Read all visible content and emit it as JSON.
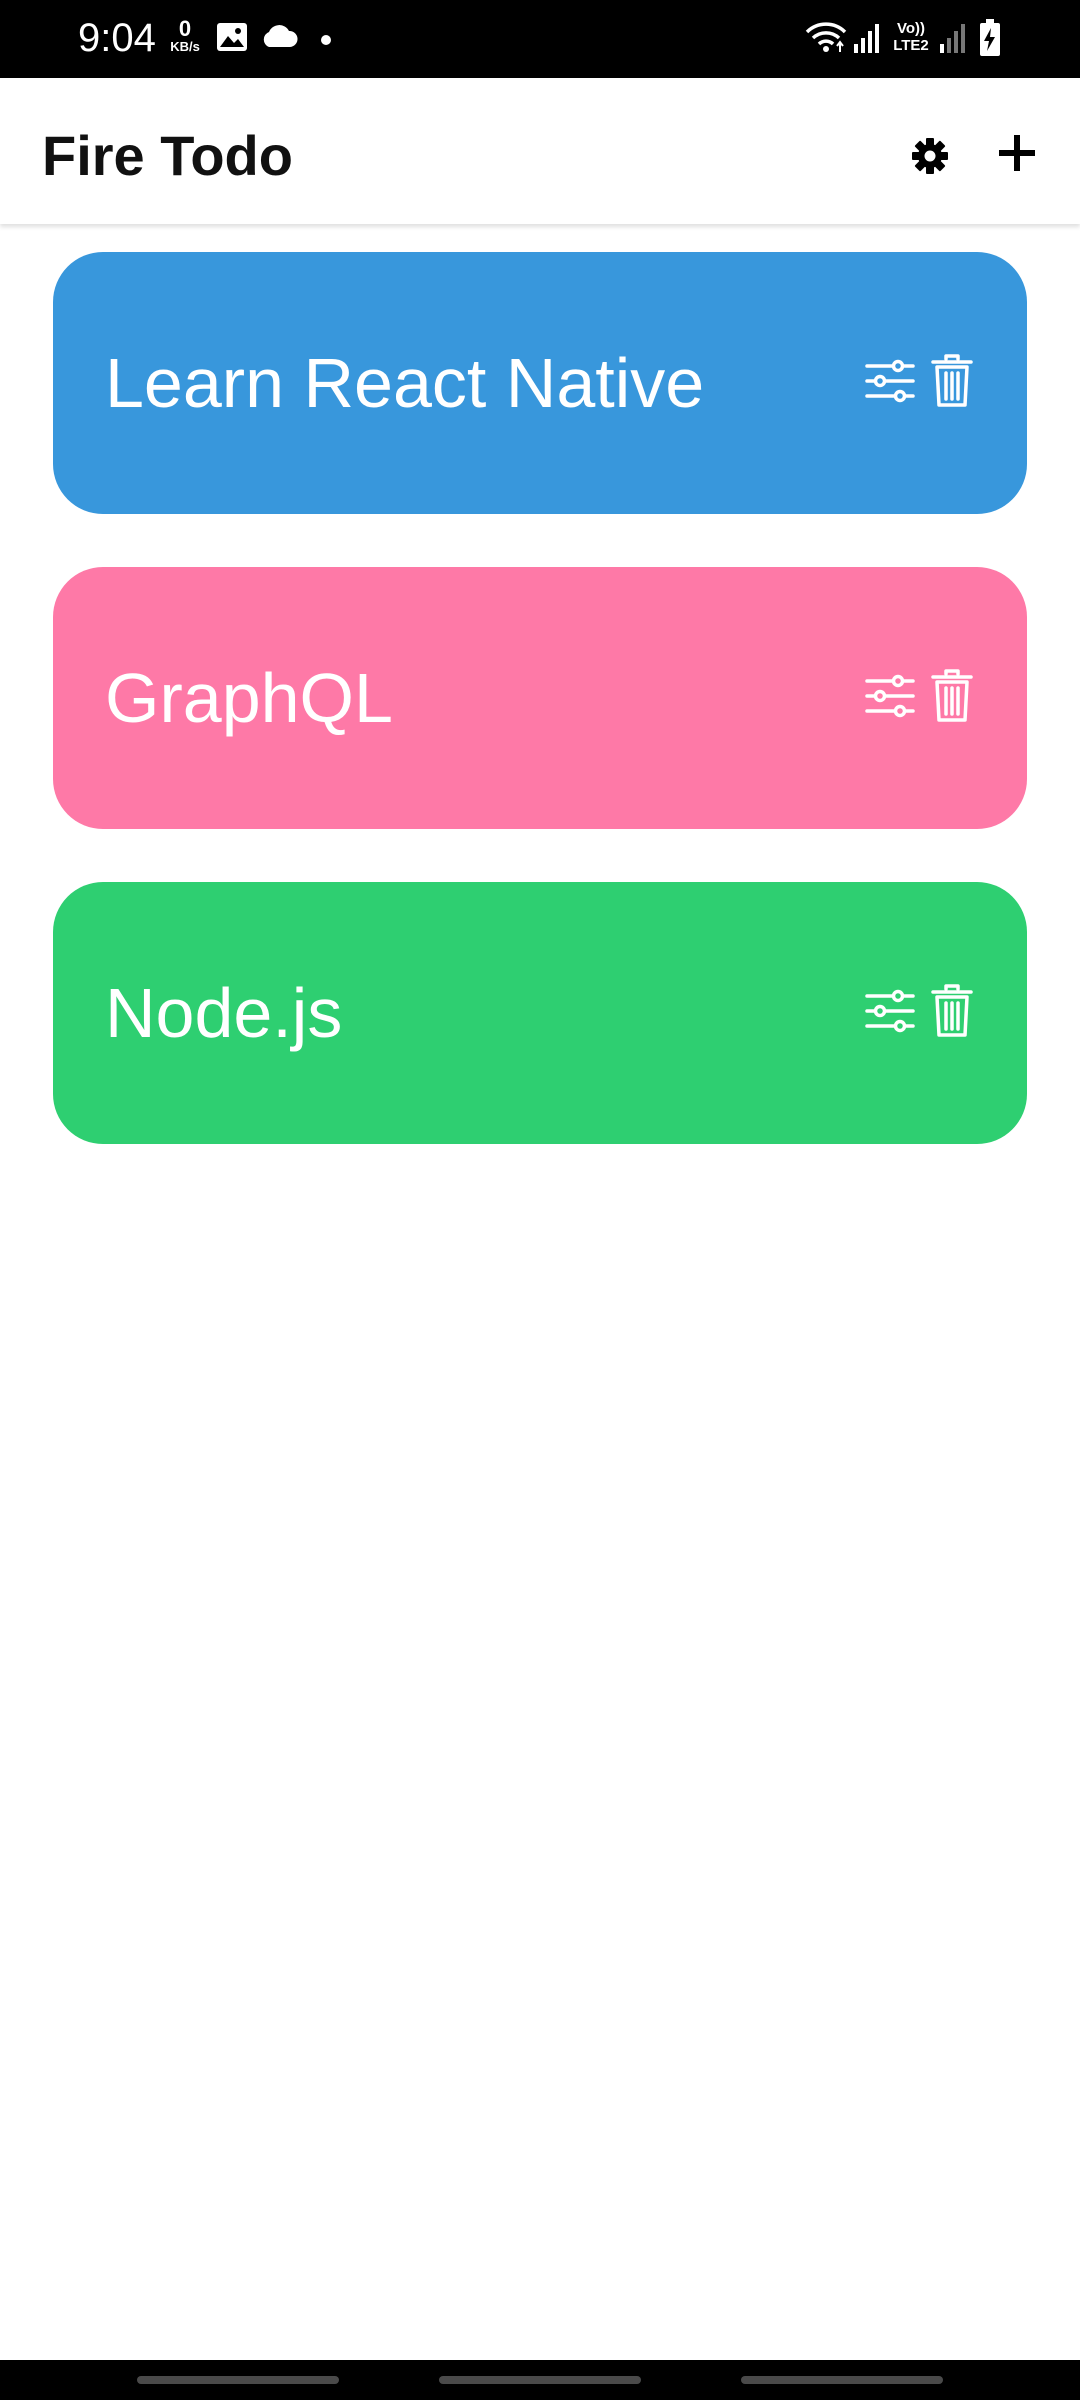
{
  "status_bar": {
    "time": "9:04",
    "net_speed_value": "0",
    "net_speed_unit": "KB/s",
    "volte_label": "Vo))",
    "lte_label": "LTE2",
    "icons": [
      "gallery-icon",
      "cloud-icon",
      "notification-dot-icon",
      "wifi-icon",
      "signal-icon",
      "signal-weak-icon",
      "battery-charging-icon"
    ]
  },
  "app_bar": {
    "title": "Fire Todo",
    "settings_icon": "gear-icon",
    "add_icon": "plus-icon"
  },
  "todos": [
    {
      "title": "Learn React Native",
      "color": "#3897dc"
    },
    {
      "title": "GraphQL",
      "color": "#fe79a7"
    },
    {
      "title": "Node.js",
      "color": "#2ecf71"
    }
  ],
  "todo_actions": {
    "edit_icon": "sliders-icon",
    "delete_icon": "trash-icon"
  },
  "colors": {
    "status_bar": "#000000",
    "app_bar": "#ffffff",
    "title_text": "#111111",
    "card_text": "#ffffff"
  }
}
